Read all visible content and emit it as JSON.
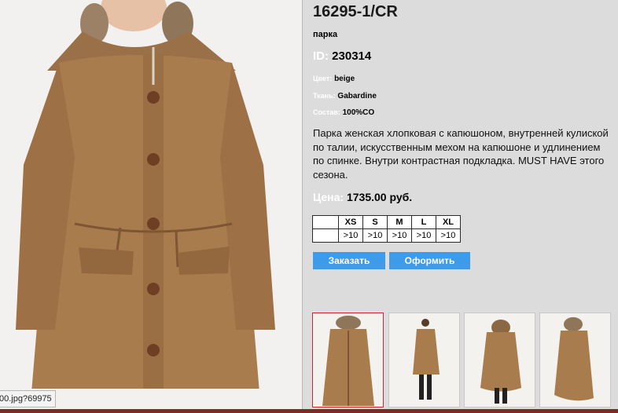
{
  "product": {
    "sku": "16295-1/CR",
    "type": "парка",
    "id_label": "ID:",
    "id_value": "230314",
    "attributes": [
      {
        "label": "Цвет:",
        "value": "beige"
      },
      {
        "label": "Ткань:",
        "value": "Gabardine"
      },
      {
        "label": "Состав:",
        "value": "100%CO"
      }
    ],
    "description": "Парка женская хлопковая с капюшоном,  внутренней кулиской по талии, искусственным мехом на капюшоне и удлинением по спинке. Внутри контрастная подкладка. MUST HAVE этого сезона.",
    "price_label": "Цена:",
    "price_value": "1735.00 руб."
  },
  "sizes": {
    "headers": [
      "XS",
      "S",
      "M",
      "L",
      "XL"
    ],
    "stock": [
      ">10",
      ">10",
      ">10",
      ">10",
      ">10"
    ]
  },
  "buttons": {
    "order": "Заказать",
    "checkout": "Оформить"
  },
  "status_tooltip": "00.jpg?69975",
  "colors": {
    "accent_button": "#3d9be9",
    "coat": "#a97c4e",
    "active_thumb_border": "#c8272d",
    "panel_bg": "#dcdcdc"
  }
}
